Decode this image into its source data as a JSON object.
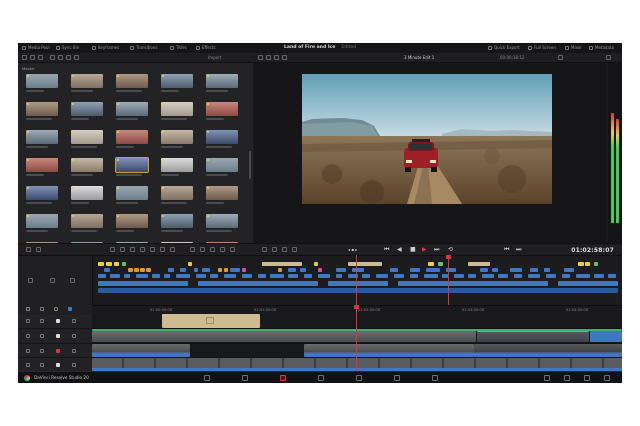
{
  "menu": {
    "media_pool": "Media Pool",
    "sync_bin": "Sync Bin",
    "keyframes": "Keyframes",
    "transitions": "Transitions",
    "titles": "Titles",
    "effects": "Effects",
    "quick_export": "Quick Export",
    "full_screen": "Full Screen",
    "mixer": "Mixer",
    "metadata": "Metadata"
  },
  "project": {
    "title": "Land of Fire and Ice",
    "status": "Edited"
  },
  "toolbar": {
    "import": "Import",
    "zoom": "00:00:18:12"
  },
  "media_pool": {
    "label": "Master",
    "thumb_count": 35
  },
  "viewer": {
    "timeline_name": "3 Minute Edit 1"
  },
  "transport": {
    "timecode": "01:02:58:07"
  },
  "ruler": {
    "ticks": [
      "01:00:00:00",
      "01:01:00:00",
      "01:02:00:00",
      "01:03:00:00",
      "01:04:00:00"
    ]
  },
  "tracks": [
    {
      "name": "video-track-2"
    },
    {
      "name": "video-track-1"
    },
    {
      "name": "audio-track-1"
    },
    {
      "name": "audio-track-2"
    }
  ],
  "footer": {
    "app_name": "DaVinci Resolve Studio 20"
  },
  "colors": {
    "accent_red": "#e0323a",
    "clip_blue": "#3f78c2",
    "clip_beige": "#cdbb92",
    "audio_green": "#4ec26a"
  },
  "icons": [
    "media-pool-icon",
    "play-icon",
    "stop-icon",
    "loop-icon",
    "cut-page-icon",
    "edit-page-icon",
    "fusion-page-icon",
    "color-page-icon",
    "fairlight-page-icon",
    "deliver-page-icon",
    "home-icon",
    "settings-icon"
  ]
}
